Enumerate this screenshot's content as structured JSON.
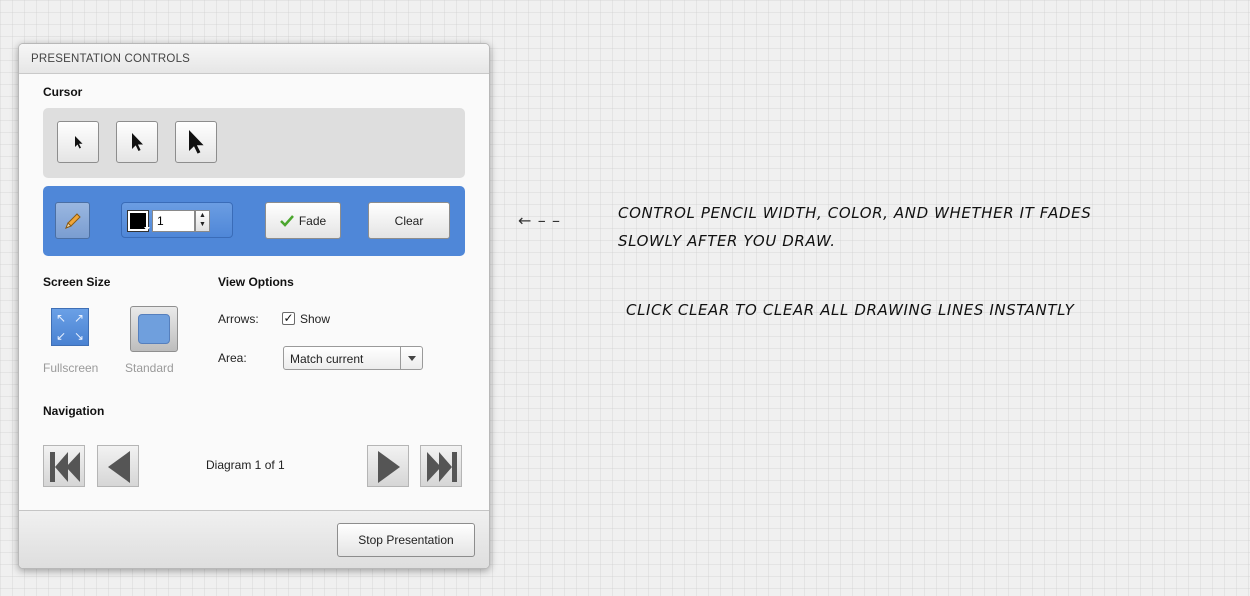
{
  "panel": {
    "title": "PRESENTATION CONTROLS",
    "cursor": {
      "label": "Cursor",
      "sizes": [
        "small-arrow-icon",
        "medium-arrow-icon",
        "large-arrow-icon"
      ]
    },
    "drawing": {
      "pencil_icon": "pencil-icon",
      "color": "#000000",
      "width_value": "1",
      "fade_label": "Fade",
      "fade_icon": "checkmark-icon",
      "clear_label": "Clear",
      "accent": "#4f87d8"
    },
    "screen_size": {
      "label": "Screen Size",
      "fullscreen_label": "Fullscreen",
      "standard_label": "Standard"
    },
    "view_options": {
      "label": "View Options",
      "arrows_label": "Arrows:",
      "show_label": "Show",
      "show_checked": true,
      "area_label": "Area:",
      "area_value": "Match current"
    },
    "navigation": {
      "label": "Navigation",
      "status": "Diagram 1 of 1"
    },
    "footer": {
      "stop_label": "Stop Presentation"
    }
  },
  "annotation": {
    "arrow": "←  – –",
    "line1": "CONTROL PENCIL WIDTH, COLOR, AND WHETHER IT FADES",
    "line2": "SLOWLY AFTER YOU DRAW.",
    "line3": "CLICK CLEAR TO CLEAR ALL DRAWING LINES INSTANTLY"
  }
}
